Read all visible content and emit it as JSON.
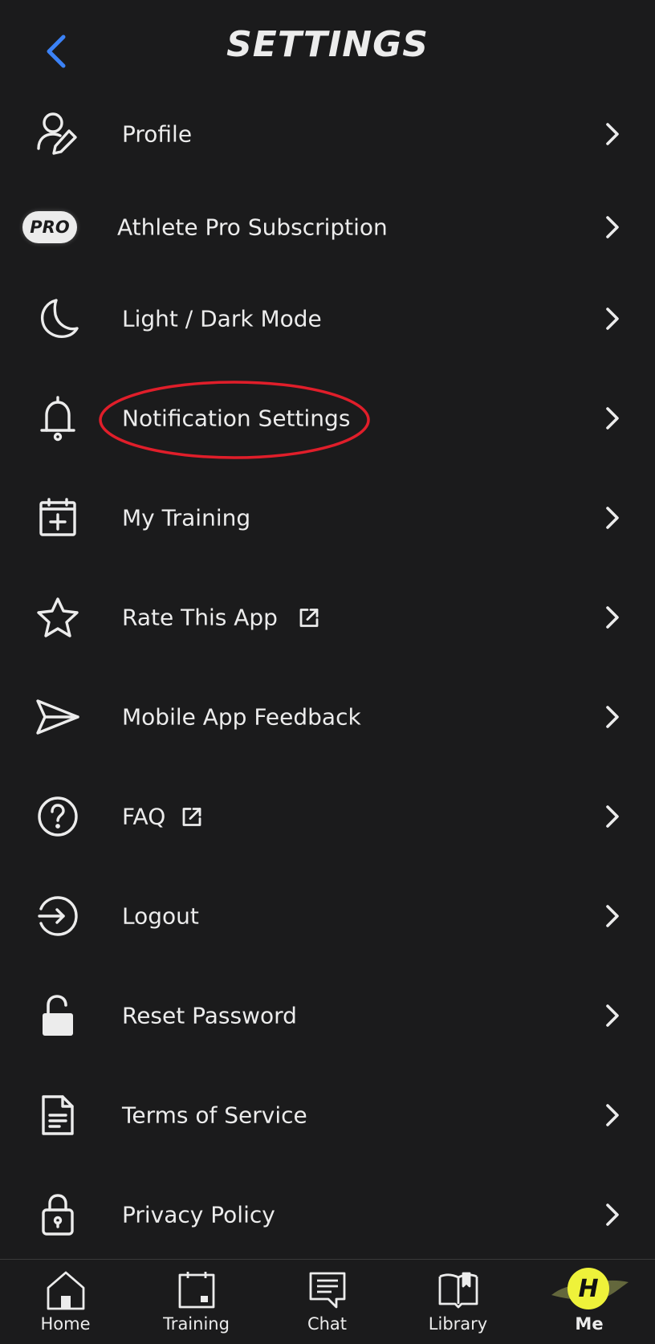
{
  "header": {
    "title": "SETTINGS",
    "back_icon": "chevron-left-icon",
    "back_color": "#3b82f6"
  },
  "menu": {
    "items": [
      {
        "label": "Profile",
        "icon": "user-edit-icon"
      },
      {
        "label": "Athlete Pro Subscription",
        "icon": "pro-badge",
        "badge_text": "PRO"
      },
      {
        "label": "Light / Dark Mode",
        "icon": "moon-icon"
      },
      {
        "label": "Notification Settings",
        "icon": "bell-icon",
        "highlighted": true
      },
      {
        "label": "My Training",
        "icon": "calendar-plus-icon"
      },
      {
        "label": "Rate This App",
        "icon": "star-icon",
        "external": true
      },
      {
        "label": "Mobile App Feedback",
        "icon": "send-icon"
      },
      {
        "label": "FAQ",
        "icon": "help-circle-icon",
        "external": true
      },
      {
        "label": "Logout",
        "icon": "logout-icon"
      },
      {
        "label": "Reset Password",
        "icon": "unlock-icon"
      },
      {
        "label": "Terms of Service",
        "icon": "document-icon"
      },
      {
        "label": "Privacy Policy",
        "icon": "lock-icon"
      }
    ]
  },
  "tabbar": {
    "tabs": [
      {
        "label": "Home",
        "icon": "home-icon"
      },
      {
        "label": "Training",
        "icon": "calendar-icon"
      },
      {
        "label": "Chat",
        "icon": "chat-icon"
      },
      {
        "label": "Library",
        "icon": "book-icon"
      },
      {
        "label": "Me",
        "icon": "avatar-logo",
        "active": true,
        "logo_letter": "H"
      }
    ]
  },
  "colors": {
    "background": "#1b1b1c",
    "text": "#ececec",
    "accent": "#3b82f6",
    "highlight": "#e01e2a",
    "logo_yellow": "#eef23a"
  }
}
